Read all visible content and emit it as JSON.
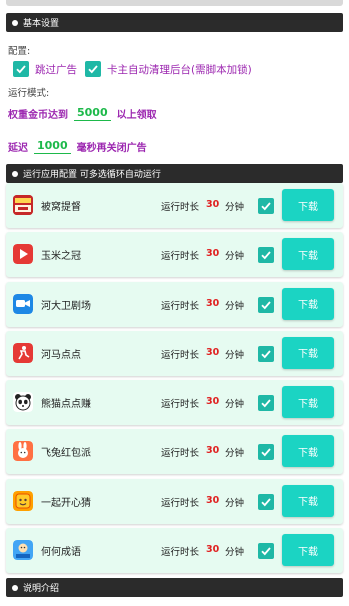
{
  "basic_settings": {
    "header": "基本设置",
    "config_label": "配置:",
    "options": [
      {
        "label": "跳过广告",
        "checked": true
      },
      {
        "label": "卡主自动清理后台(需脚本加锁)",
        "checked": true
      }
    ],
    "mode_label": "运行模式:",
    "weight_prefix": "权重金币达到",
    "weight_value": "5000",
    "weight_suffix": "以上领取",
    "delay_prefix": "延迟",
    "delay_value": "1000",
    "delay_suffix": "毫秒再关闭广告"
  },
  "apps_section": {
    "header": "运行应用配置 可多选循环自动运行",
    "runtime_label": "运行时长",
    "unit": "分钟",
    "download_label": "下载",
    "apps": [
      {
        "name": "被窝提督",
        "runtime": "30",
        "icon": "bei-wo-icon",
        "checked": true
      },
      {
        "name": "玉米之冠",
        "runtime": "30",
        "icon": "yu-mi-icon",
        "checked": true
      },
      {
        "name": "河大卫剧场",
        "runtime": "30",
        "icon": "video-camera-icon",
        "checked": true
      },
      {
        "name": "河马点点",
        "runtime": "30",
        "icon": "runner-icon",
        "checked": true
      },
      {
        "name": "熊猫点点赚",
        "runtime": "30",
        "icon": "panda-icon",
        "checked": true
      },
      {
        "name": "飞兔红包派",
        "runtime": "30",
        "icon": "rabbit-icon",
        "checked": true
      },
      {
        "name": "一起开心猜",
        "runtime": "30",
        "icon": "game-icon",
        "checked": true
      },
      {
        "name": "何何成语",
        "runtime": "30",
        "icon": "idiom-icon",
        "checked": true
      }
    ]
  },
  "instructions_section": {
    "header": "说明介绍"
  },
  "colors": {
    "accent": "#1bd4c3",
    "checkbox": "#1fb8a6",
    "purple_text": "#9c27b0",
    "green_value": "#1db94a",
    "red_value": "#e02020",
    "row_bg": "#e6fbf1",
    "header_bg": "#2b2b2b"
  }
}
